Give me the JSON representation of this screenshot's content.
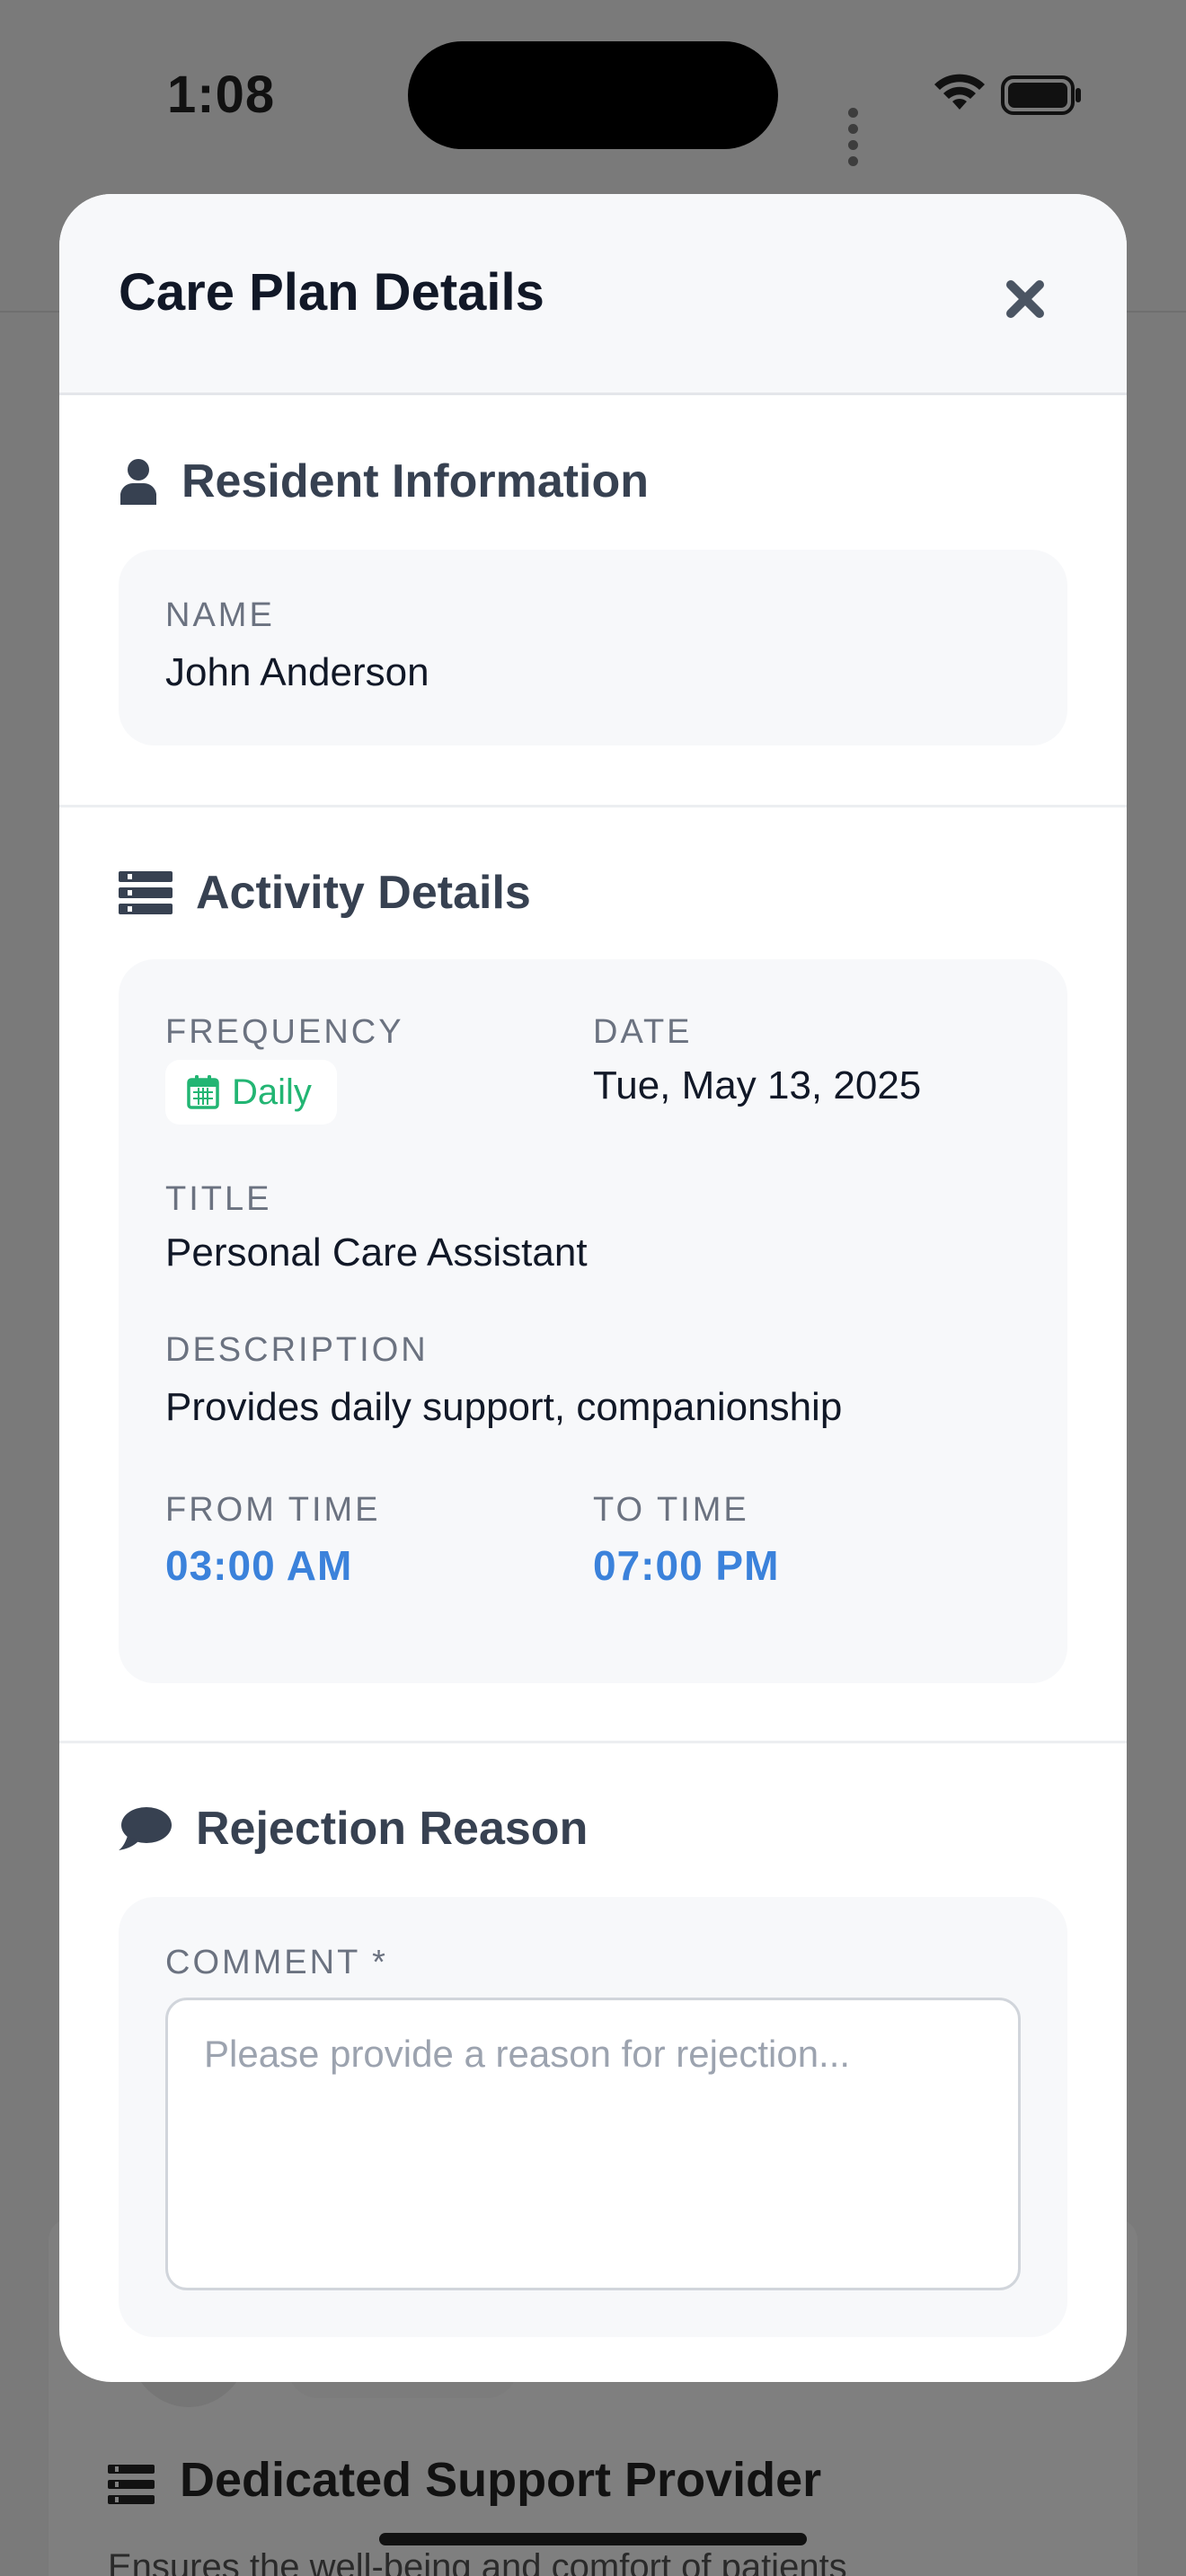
{
  "status_bar": {
    "time": "1:08"
  },
  "modal": {
    "title": "Care Plan Details",
    "close_icon": "close-icon"
  },
  "resident": {
    "heading": "Resident Information",
    "icon": "user-icon",
    "name_label": "NAME",
    "name_value": "John Anderson"
  },
  "activity": {
    "heading": "Activity Details",
    "icon": "list-icon",
    "frequency_label": "FREQUENCY",
    "frequency_value": "Daily",
    "frequency_icon": "calendar-icon",
    "date_label": "DATE",
    "date_value": "Tue, May 13, 2025",
    "title_label": "TITLE",
    "title_value": "Personal Care Assistant",
    "description_label": "DESCRIPTION",
    "description_value": "Provides daily support, companionship",
    "from_time_label": "FROM TIME",
    "from_time_value": "03:00 AM",
    "to_time_label": "TO TIME",
    "to_time_value": "07:00 PM"
  },
  "rejection": {
    "heading": "Rejection Reason",
    "icon": "comment-icon",
    "comment_label": "COMMENT *",
    "comment_value": "",
    "comment_placeholder": "Please provide a reason for rejection..."
  },
  "background_page": {
    "card_title": "Dedicated Support Provider",
    "card_text": "Ensures the well-being and comfort of patients"
  },
  "colors": {
    "accent_blue": "#3b82db",
    "badge_green": "#22b573",
    "title_dark": "#111827"
  }
}
